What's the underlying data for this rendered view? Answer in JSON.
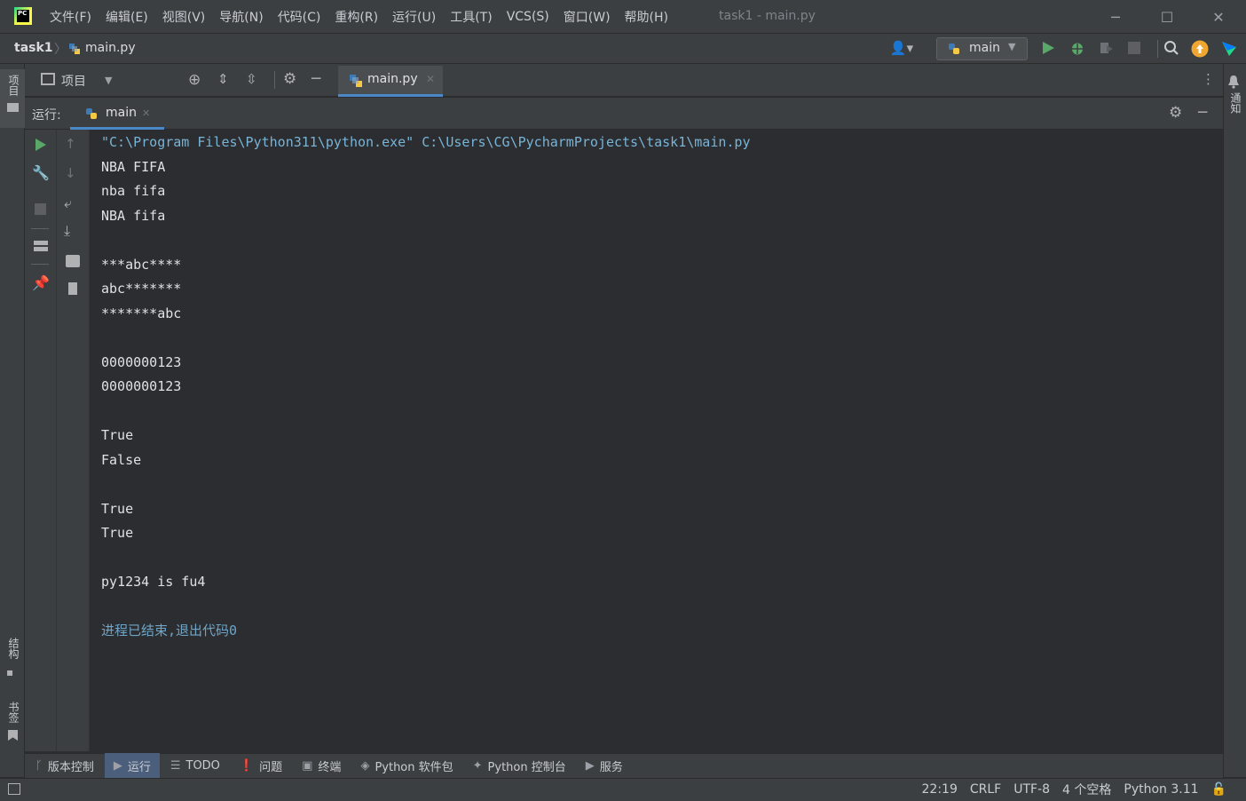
{
  "app": {
    "logo_text": "PC",
    "window_title": "task1 - main.py",
    "colors": {
      "bg": "#2b2d30",
      "panel": "#3c3f41",
      "accent": "#4a88c7",
      "run_green": "#59a869",
      "console_cmd": "#79b4d6"
    }
  },
  "menu": [
    "文件(F)",
    "编辑(E)",
    "视图(V)",
    "导航(N)",
    "代码(C)",
    "重构(R)",
    "运行(U)",
    "工具(T)",
    "VCS(S)",
    "窗口(W)",
    "帮助(H)"
  ],
  "breadcrumb": {
    "project": "task1",
    "file": "main.py"
  },
  "toolbar": {
    "run_config": "main",
    "icons": [
      "user-icon",
      "python-icon",
      "run-icon",
      "debug-icon",
      "coverage-icon",
      "stop-icon",
      "search-icon",
      "update-icon",
      "jetbrains-icon"
    ]
  },
  "left_strip": {
    "project": "项目",
    "structure": "结构",
    "bookmarks": "书签"
  },
  "right_strip": {
    "notifications": "通知"
  },
  "project_bar": {
    "label": "项目",
    "tab": "main.py"
  },
  "run_bar": {
    "label": "运行:",
    "tab": "main"
  },
  "console": {
    "command": "\"C:\\Program Files\\Python311\\python.exe\" C:\\Users\\CG\\PycharmProjects\\task1\\main.py",
    "lines": [
      "NBA FIFA",
      "nba fifa",
      "NBA fifa",
      "",
      "***abc****",
      "abc*******",
      "*******abc",
      "",
      "0000000123",
      "0000000123",
      "",
      "True",
      "False",
      "",
      "True",
      "True",
      "",
      "py1234 is fu4",
      ""
    ],
    "exit_message": "进程已结束,退出代码0"
  },
  "bottom_tools": [
    "版本控制",
    "运行",
    "TODO",
    "问题",
    "终端",
    "Python 软件包",
    "Python 控制台",
    "服务"
  ],
  "status": {
    "position": "22:19",
    "line_sep": "CRLF",
    "encoding": "UTF-8",
    "indent": "4 个空格",
    "interpreter": "Python 3.11"
  }
}
